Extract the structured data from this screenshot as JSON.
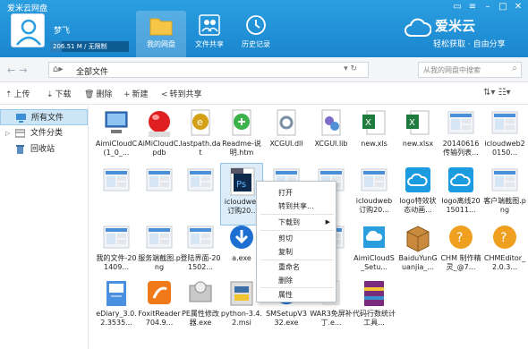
{
  "window": {
    "title": "爱米云网盘"
  },
  "user": {
    "name": "梦飞",
    "quota_text": "206.51 M / 无限制",
    "quota_used_fraction": 0.15
  },
  "nav": [
    {
      "label": "我的网盘"
    },
    {
      "label": "文件共享"
    },
    {
      "label": "历史记录"
    }
  ],
  "brand": {
    "name": "爱米云",
    "slogan": "轻松获取 · 自由分享"
  },
  "address": {
    "crumb": "全部文件",
    "search_placeholder": "从我的网盘中搜索"
  },
  "toolbar": {
    "upload": "上传",
    "download": "下载",
    "delete": "删除",
    "new": "新建",
    "share": "转到共享"
  },
  "sidebar": [
    {
      "label": "所有文件"
    },
    {
      "label": "文件分类"
    },
    {
      "label": "回收站"
    }
  ],
  "files": [
    {
      "name": "AimiCloudC(1_0_...",
      "icon": "computer-icon"
    },
    {
      "name": "AiMiCloudC.pdb",
      "icon": "red-ball-icon"
    },
    {
      "name": "lastpath.dat",
      "icon": "uedit-icon"
    },
    {
      "name": "Readme-说明.htm",
      "icon": "html-icon"
    },
    {
      "name": "XCGUI.dll",
      "icon": "dll-icon"
    },
    {
      "name": "XCGUI.lib",
      "icon": "lib-icon"
    },
    {
      "name": "new.xls",
      "icon": "excel-icon"
    },
    {
      "name": "new.xlsx",
      "icon": "excel-icon"
    },
    {
      "name": "20140616传输列表...",
      "icon": "image-thumb-icon"
    },
    {
      "name": "icloudweb20150...",
      "icon": "image-thumb-icon"
    },
    {
      "name": "",
      "icon": "image-thumb-icon"
    },
    {
      "name": "",
      "icon": "image-thumb-icon"
    },
    {
      "name": "",
      "icon": "image-thumb-icon"
    },
    {
      "name": "icloudweb订购20...",
      "icon": "psd-icon"
    },
    {
      "name": "",
      "icon": "image-thumb-icon"
    },
    {
      "name": "",
      "icon": "image-thumb-icon"
    },
    {
      "name": "icloudweb订购20...",
      "icon": "image-thumb-icon"
    },
    {
      "name": "logo特效状态动画...",
      "icon": "cloud-logo-icon"
    },
    {
      "name": "logo离线2015011...",
      "icon": "cloud-logo-icon"
    },
    {
      "name": "客户端截图.png",
      "icon": "image-thumb-icon"
    },
    {
      "name": "我的文件-201409...",
      "icon": "image-thumb-icon"
    },
    {
      "name": "服务端截图.png",
      "icon": "image-thumb-icon"
    },
    {
      "name": "登陆界面-201502...",
      "icon": "image-thumb-icon"
    },
    {
      "name": "a.exe",
      "icon": "download-exe-icon"
    },
    {
      "name": "",
      "icon": "image-thumb-icon"
    },
    {
      "name": "",
      "icon": "image-thumb-icon"
    },
    {
      "name": "AimiCloudS_Setu...",
      "icon": "setup-icon"
    },
    {
      "name": "BaiduYunGuanjia_...",
      "icon": "box-icon"
    },
    {
      "name": "CHM 制作精灵_@7...",
      "icon": "chm-icon"
    },
    {
      "name": "CHMEditor_2.0.3...",
      "icon": "chm-icon"
    },
    {
      "name": "eDiary_3.0.2.3535...",
      "icon": "diary-icon"
    },
    {
      "name": "FoxitReader704.9...",
      "icon": "foxit-icon"
    },
    {
      "name": "PE属性修改器.exe",
      "icon": "pe-icon"
    },
    {
      "name": "python-3.4.2.msi",
      "icon": "python-icon"
    },
    {
      "name": "SMSetupV332.exe",
      "icon": "download-exe-icon"
    },
    {
      "name": "WAR3免屏补丁.e...",
      "icon": "blank-icon"
    },
    {
      "name": "代码行数统计工具...",
      "icon": "winrar-icon"
    }
  ],
  "context_menu": [
    "打开",
    "转到共享...",
    "下载到",
    "剪切",
    "复制",
    "重命名",
    "删除",
    "属性"
  ]
}
